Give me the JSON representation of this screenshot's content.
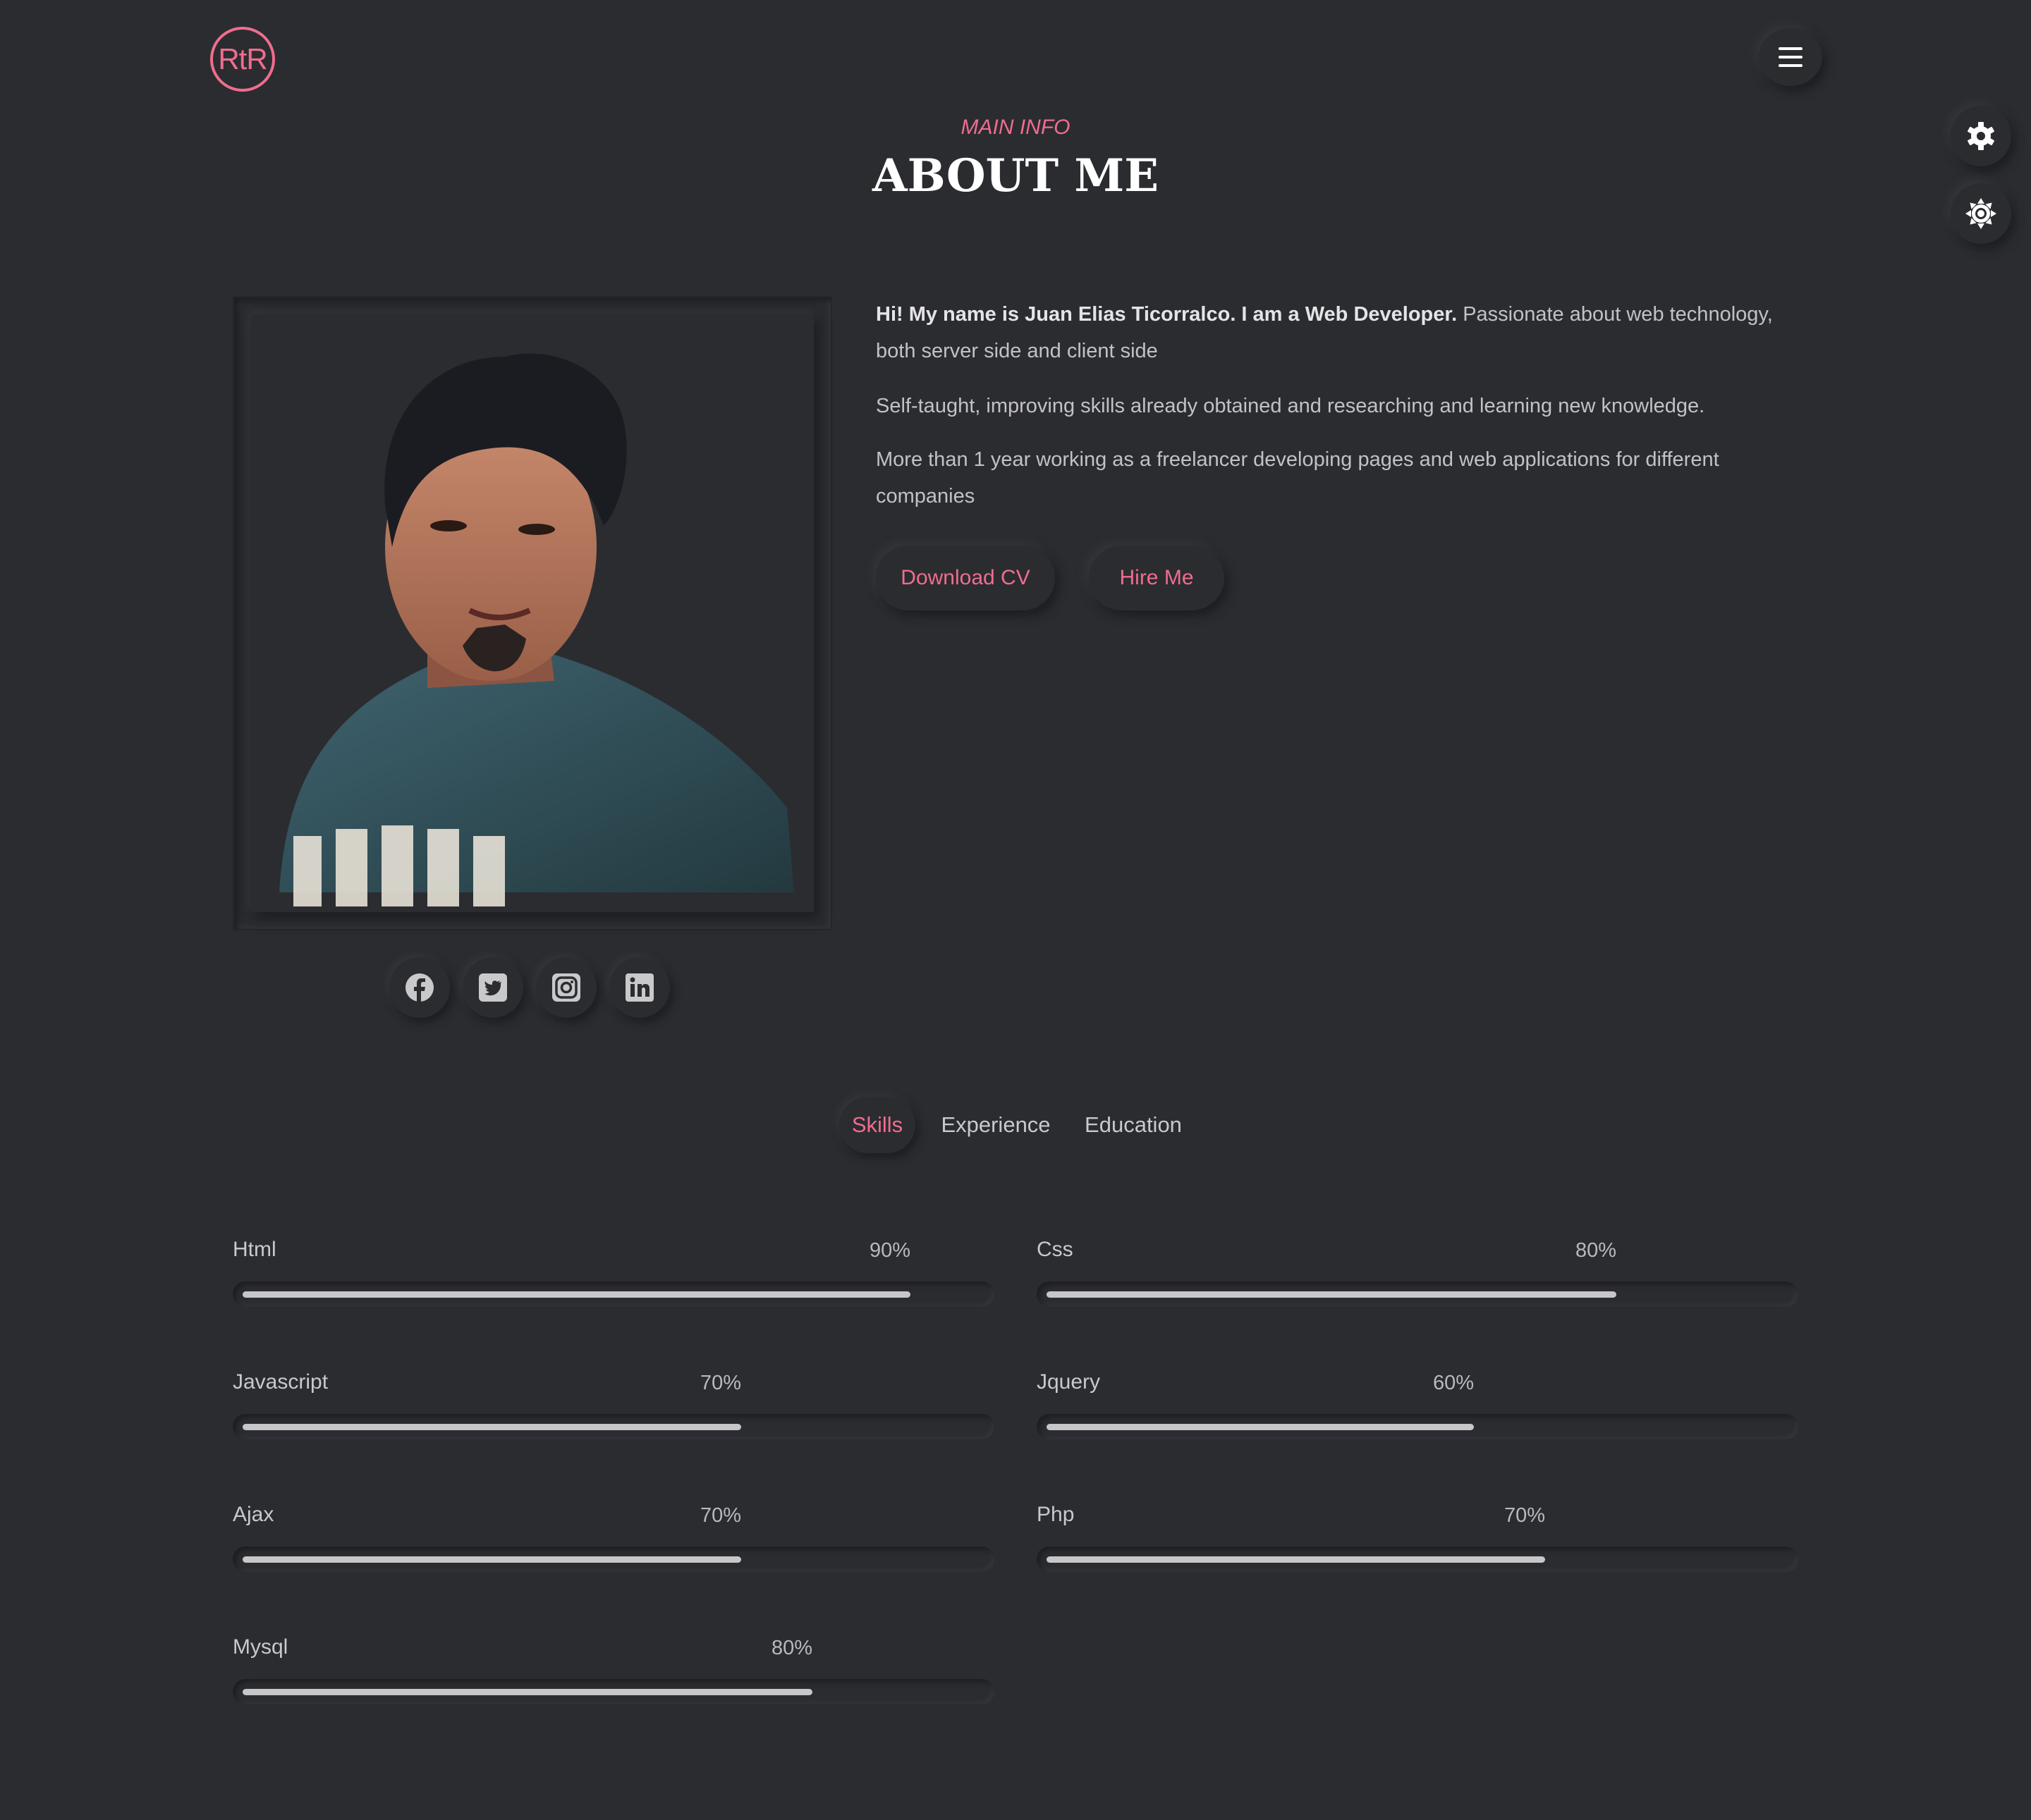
{
  "header": {
    "logo_text": "RtR"
  },
  "section": {
    "subtitle": "MAIN INFO",
    "title": "ABOUT ME"
  },
  "bio": {
    "intro_bold": "Hi! My name is Juan Elias Ticorralco. I am a Web Developer.",
    "intro_rest": " Passionate about web technology, both server side and client side",
    "paragraph2": "Self-taught, improving skills already obtained and researching and learning new knowledge.",
    "paragraph3": "More than 1 year working as a freelancer developing pages and web applications for different companies"
  },
  "buttons": {
    "download_cv": "Download CV",
    "hire_me": "Hire Me"
  },
  "socials": [
    "facebook-icon",
    "twitter-icon",
    "instagram-icon",
    "linkedin-icon"
  ],
  "tabs": [
    {
      "label": "Skills",
      "active": true
    },
    {
      "label": "Experience",
      "active": false
    },
    {
      "label": "Education",
      "active": false
    }
  ],
  "skills": [
    {
      "name": "Html",
      "percent_label": "90%",
      "value": 0.9
    },
    {
      "name": "Css",
      "percent_label": "80%",
      "value": 0.8
    },
    {
      "name": "Javascript",
      "percent_label": "70%",
      "value": 0.7
    },
    {
      "name": "Jquery",
      "percent_label": "60%",
      "value": 0.6
    },
    {
      "name": "Ajax",
      "percent_label": "70%",
      "value": 0.7
    },
    {
      "name": "Php",
      "percent_label": "70%",
      "value": 0.7
    },
    {
      "name": "Mysql",
      "percent_label": "80%",
      "value": 0.8
    }
  ],
  "colors": {
    "accent": "#ef6d8e",
    "background": "#2b2c30",
    "bar_fill": "#c7c7c9"
  }
}
